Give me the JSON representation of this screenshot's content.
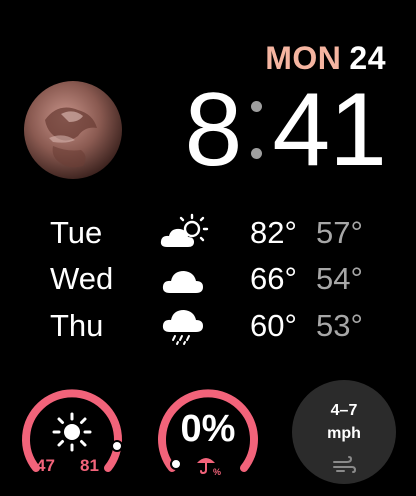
{
  "date": {
    "weekday": "MON",
    "day": "24"
  },
  "time": {
    "hour": "8",
    "minute": "41"
  },
  "planet": {
    "icon": "earth-icon"
  },
  "forecast": [
    {
      "day": "Tue",
      "icon": "partly-sunny-icon",
      "high": "82°",
      "low": "57°"
    },
    {
      "day": "Wed",
      "icon": "cloud-icon",
      "high": "66°",
      "low": "54°"
    },
    {
      "day": "Thu",
      "icon": "rain-cloud-icon",
      "high": "60°",
      "low": "53°"
    }
  ],
  "complications": {
    "uv": {
      "icon": "sun-icon",
      "low": "47",
      "high": "81"
    },
    "rain": {
      "value": "0%",
      "icon": "umbrella-icon",
      "icon_label": "%"
    },
    "wind": {
      "value": "4–7",
      "unit": "mph",
      "icon": "wind-icon"
    }
  },
  "colors": {
    "accent": "#f2637a",
    "date": "#f5b5a1",
    "secondary": "#a7a7a7"
  }
}
